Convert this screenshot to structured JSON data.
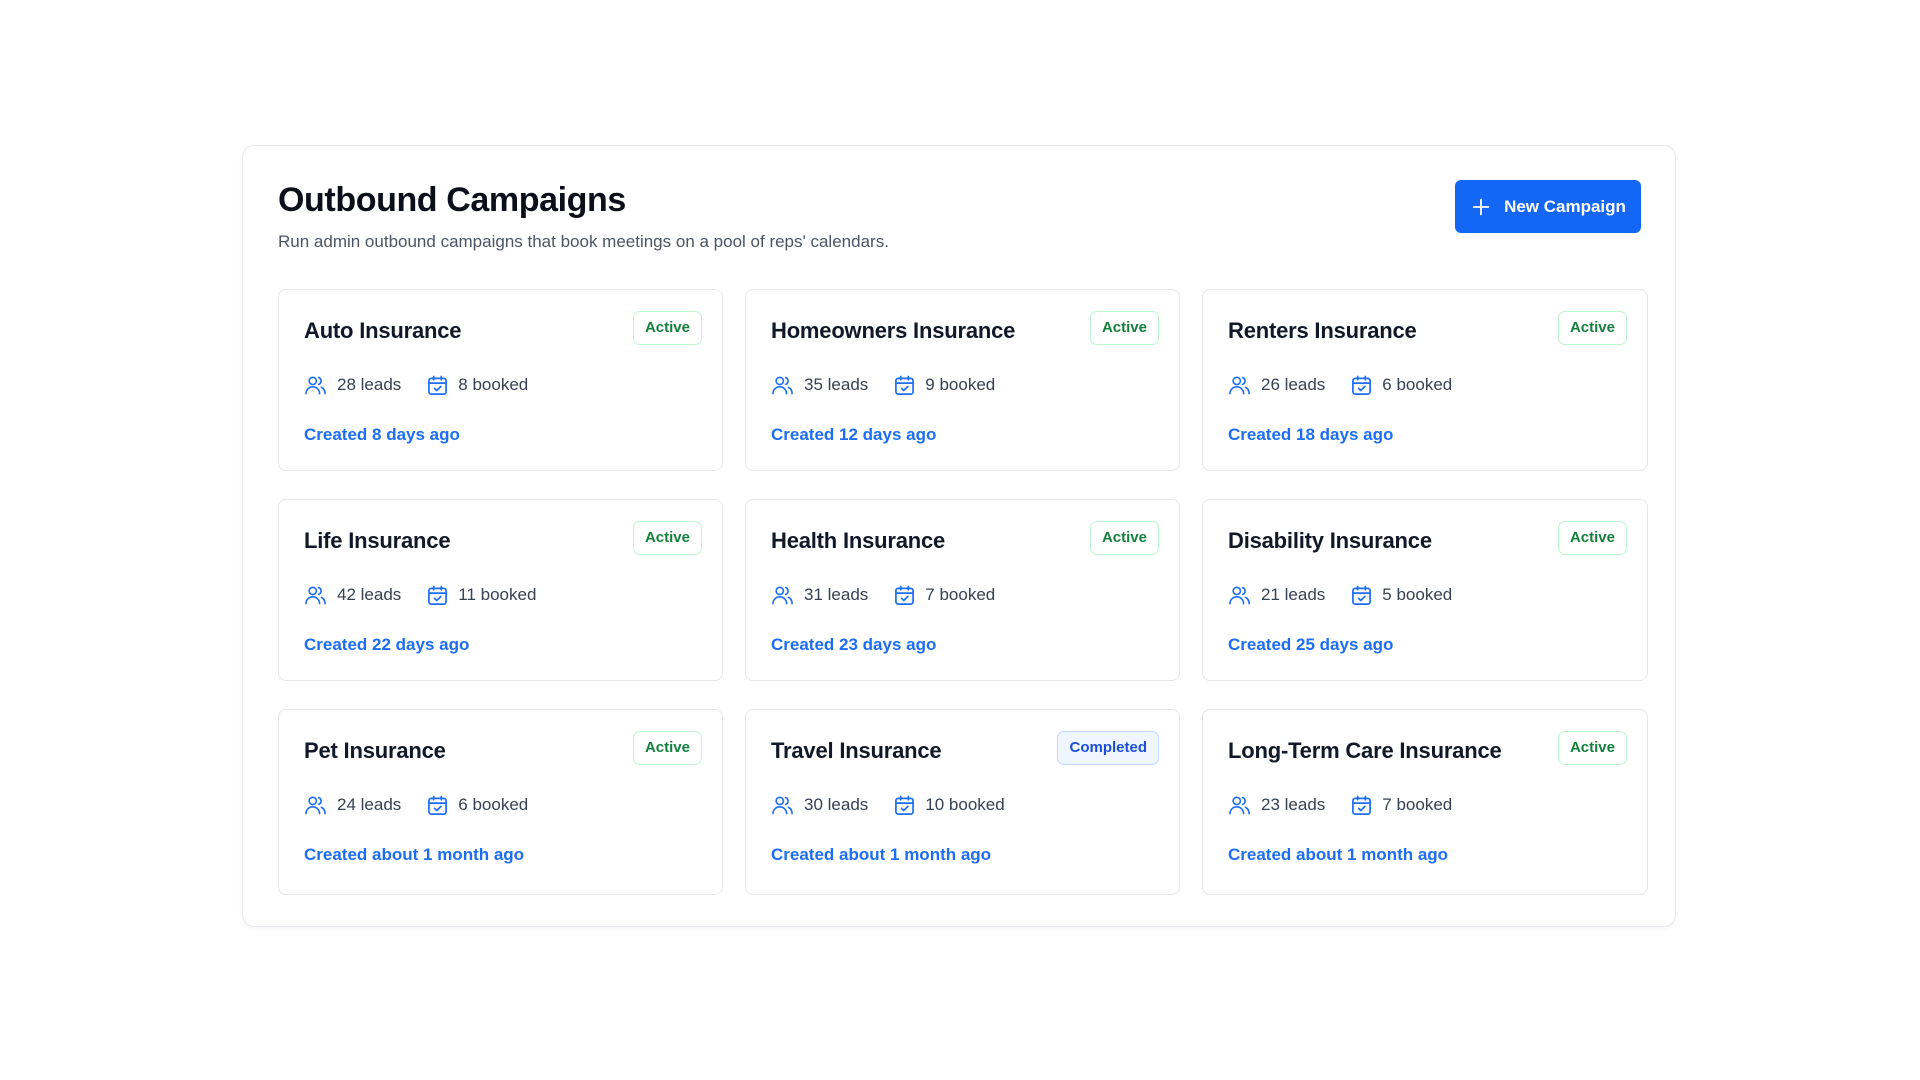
{
  "header": {
    "title": "Outbound Campaigns",
    "subtitle": "Run admin outbound campaigns that book meetings on a pool of reps' calendars.",
    "new_button_label": "New Campaign",
    "new_button_icon": "plus-icon"
  },
  "colors": {
    "accent": "#1466f5",
    "link": "#1d6ef5",
    "active": "#15803d",
    "completed": "#1d4ed8"
  },
  "icons": {
    "leads": "users-icon",
    "booked": "calendar-check-icon"
  },
  "campaigns": [
    {
      "name": "Auto Insurance",
      "status": "Active",
      "leads": "28 leads",
      "booked": "8 booked",
      "created": "Created 8 days ago"
    },
    {
      "name": "Homeowners Insurance",
      "status": "Active",
      "leads": "35 leads",
      "booked": "9 booked",
      "created": "Created 12 days ago"
    },
    {
      "name": "Renters Insurance",
      "status": "Active",
      "leads": "26 leads",
      "booked": "6 booked",
      "created": "Created 18 days ago"
    },
    {
      "name": "Life Insurance",
      "status": "Active",
      "leads": "42 leads",
      "booked": "11 booked",
      "created": "Created 22 days ago"
    },
    {
      "name": "Health Insurance",
      "status": "Active",
      "leads": "31 leads",
      "booked": "7 booked",
      "created": "Created 23 days ago"
    },
    {
      "name": "Disability Insurance",
      "status": "Active",
      "leads": "21 leads",
      "booked": "5 booked",
      "created": "Created 25 days ago"
    },
    {
      "name": "Pet Insurance",
      "status": "Active",
      "leads": "24 leads",
      "booked": "6 booked",
      "created": "Created about 1 month ago"
    },
    {
      "name": "Travel Insurance",
      "status": "Completed",
      "leads": "30 leads",
      "booked": "10 booked",
      "created": "Created about 1 month ago"
    },
    {
      "name": "Long-Term Care Insurance",
      "status": "Active",
      "leads": "23 leads",
      "booked": "7 booked",
      "created": "Created about 1 month ago"
    }
  ]
}
